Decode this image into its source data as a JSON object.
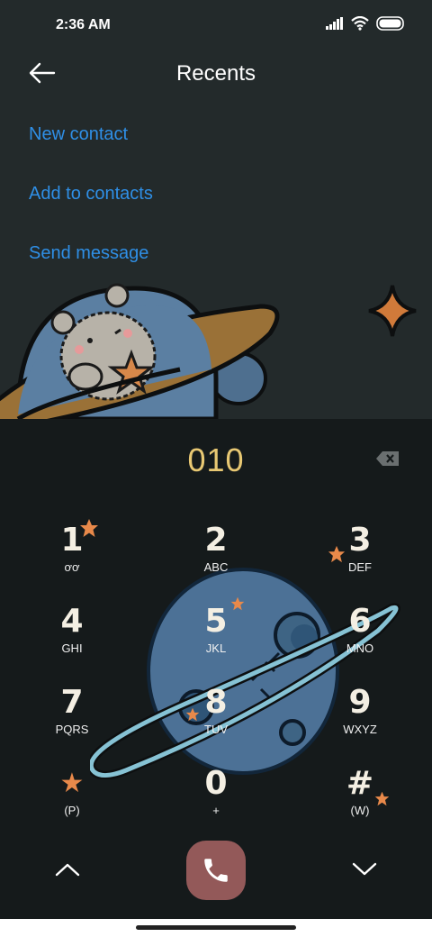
{
  "status": {
    "time": "2:36 AM"
  },
  "header": {
    "title": "Recents"
  },
  "actions": {
    "new_contact": "New contact",
    "add_to_contacts": "Add to contacts",
    "send_message": "Send message"
  },
  "dialer": {
    "number": "010"
  },
  "keys": [
    {
      "digit": "1",
      "letters": "ơơ"
    },
    {
      "digit": "2",
      "letters": "ABC"
    },
    {
      "digit": "3",
      "letters": "DEF"
    },
    {
      "digit": "4",
      "letters": "GHI"
    },
    {
      "digit": "5",
      "letters": "JKL"
    },
    {
      "digit": "6",
      "letters": "MNO"
    },
    {
      "digit": "7",
      "letters": "PQRS"
    },
    {
      "digit": "8",
      "letters": "TUV"
    },
    {
      "digit": "9",
      "letters": "WXYZ"
    },
    {
      "digit": "★",
      "letters": "(P)"
    },
    {
      "digit": "0",
      "letters": "+"
    },
    {
      "digit": "#",
      "letters": "(W)"
    }
  ],
  "colors": {
    "link": "#2f8fe6",
    "number": "#e8c873",
    "call_button": "#935959",
    "star": "#e8894a"
  }
}
